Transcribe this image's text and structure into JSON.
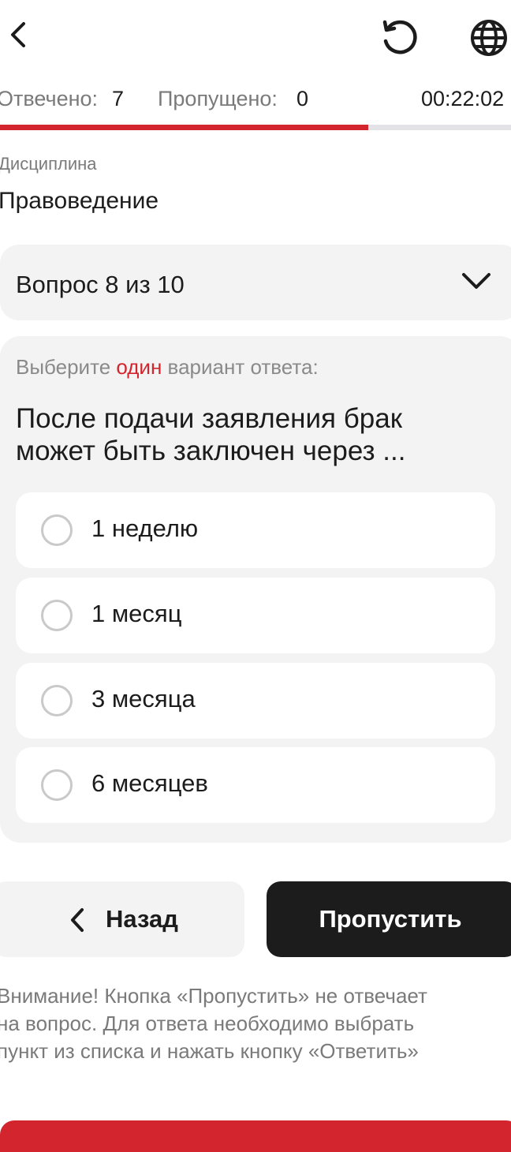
{
  "icons": {
    "back": "chevron-left-icon",
    "reset": "reload-icon",
    "language": "globe-icon",
    "dropdown": "chevron-down-icon"
  },
  "stats": {
    "answered_label": "Отвечено:",
    "answered_value": "7",
    "skipped_label": "Пропущено:",
    "skipped_value": "0",
    "timer": "00:22:02"
  },
  "progress": {
    "fraction": 0.72
  },
  "discipline": {
    "label": "Дисциплина",
    "value": "Правоведение"
  },
  "question_selector": {
    "text": "Вопрос 8 из 10"
  },
  "question": {
    "hint_prefix": "Выберите ",
    "hint_accent": "один",
    "hint_suffix": " вариант ответа:",
    "text": "После подачи заявления брак может быть заключен через ...",
    "options": [
      {
        "label": "1 неделю",
        "selected": false
      },
      {
        "label": "1 месяц",
        "selected": false
      },
      {
        "label": "3 месяца",
        "selected": false
      },
      {
        "label": "6 месяцев",
        "selected": false
      }
    ]
  },
  "actions": {
    "back_label": "Назад",
    "skip_label": "Пропустить"
  },
  "warning": {
    "lines": [
      "Внимание! Кнопка «Пропустить» не отвечает",
      "на вопрос. Для ответа необходимо выбрать",
      "пункт из списка и нажать кнопку «Ответить»"
    ]
  },
  "colors": {
    "accent": "#d3252d",
    "dark": "#1c1c1c",
    "muted": "#7a7a7a",
    "panel": "#f3f3f3"
  }
}
